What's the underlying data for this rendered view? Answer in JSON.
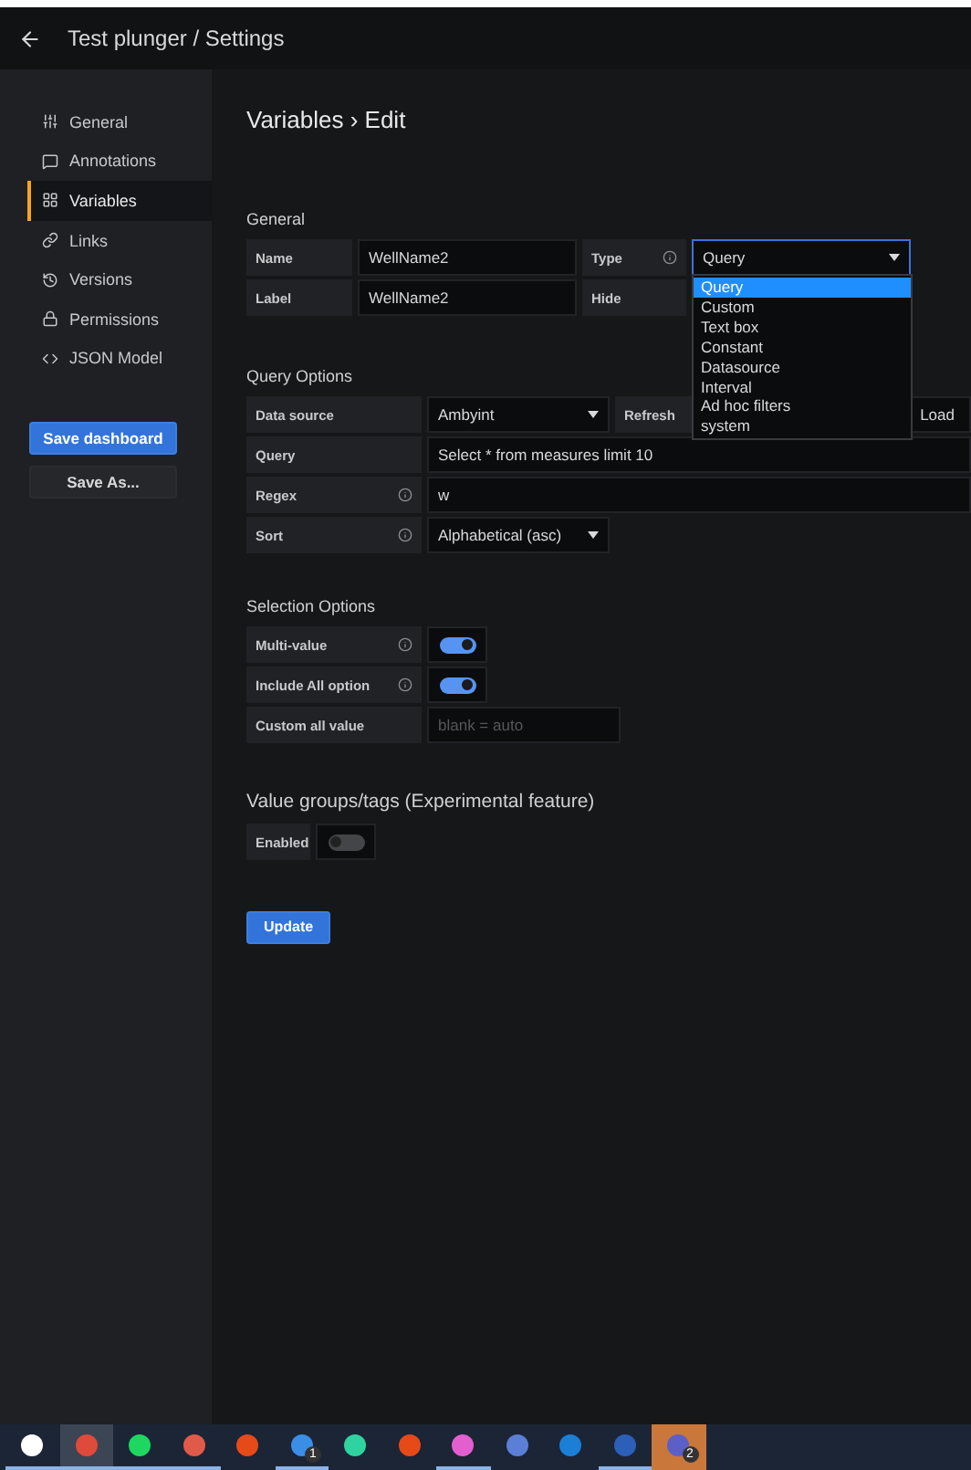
{
  "header": {
    "title": "Test plunger / Settings"
  },
  "sidebar": {
    "items": [
      {
        "label": "General",
        "selected": false
      },
      {
        "label": "Annotations",
        "selected": false
      },
      {
        "label": "Variables",
        "selected": true
      },
      {
        "label": "Links",
        "selected": false
      },
      {
        "label": "Versions",
        "selected": false
      },
      {
        "label": "Permissions",
        "selected": false
      },
      {
        "label": "JSON Model",
        "selected": false
      }
    ],
    "buttons": [
      {
        "label": "Save dashboard",
        "kind": "primary"
      },
      {
        "label": "Save As...",
        "kind": "secondary"
      }
    ]
  },
  "page_title": "Variables › Edit",
  "general": {
    "heading": "General",
    "name": {
      "label": "Name",
      "value": "WellName2"
    },
    "type": {
      "label": "Type",
      "value": "Query",
      "options": [
        {
          "label": "Query",
          "selected": true
        },
        {
          "label": "Custom",
          "selected": false
        },
        {
          "label": "Text box",
          "selected": false
        },
        {
          "label": "Constant",
          "selected": false
        },
        {
          "label": "Datasource",
          "selected": false
        },
        {
          "label": "Interval",
          "selected": false
        },
        {
          "label": "Ad hoc filters",
          "selected": false
        },
        {
          "label": "system",
          "selected": false
        }
      ]
    },
    "display_label": {
      "label": "Label",
      "value": "WellName2"
    },
    "hide": {
      "label": "Hide"
    }
  },
  "query_options": {
    "heading": "Query Options",
    "data_source": {
      "label": "Data source",
      "value": "Ambyint"
    },
    "refresh": {
      "label": "Refresh",
      "value": "Load"
    },
    "query": {
      "label": "Query",
      "value": "Select * from measures limit 10"
    },
    "regex": {
      "label": "Regex",
      "value": "w"
    },
    "sort": {
      "label": "Sort",
      "value": "Alphabetical (asc)"
    }
  },
  "selection_options": {
    "heading": "Selection Options",
    "multi_value": {
      "label": "Multi-value",
      "on": true
    },
    "include_all": {
      "label": "Include All option",
      "on": true
    },
    "custom_all": {
      "label": "Custom all value",
      "placeholder": "blank = auto"
    }
  },
  "value_groups": {
    "heading": "Value groups/tags (Experimental feature)",
    "enabled": {
      "label": "Enabled",
      "on": false
    }
  },
  "update_button": "Update",
  "taskbar": [
    {
      "color": "#ffffff",
      "selected": false,
      "running": true
    },
    {
      "color": "#e04a3a",
      "selected": true,
      "running": true
    },
    {
      "color": "#1ed760",
      "selected": false,
      "running": true
    },
    {
      "color": "#e05a4a",
      "selected": false,
      "running": true
    },
    {
      "color": "#e64a19",
      "selected": false,
      "running": false
    },
    {
      "color": "#3a8ee6",
      "selected": false,
      "running": true,
      "badge": "1"
    },
    {
      "color": "#2fd3a0",
      "selected": false,
      "running": false
    },
    {
      "color": "#e64a19",
      "selected": false,
      "running": false
    },
    {
      "color": "#e35fd0",
      "selected": false,
      "running": true
    },
    {
      "color": "#5b7fd6",
      "selected": false,
      "running": false
    },
    {
      "color": "#1b7fd6",
      "selected": false,
      "running": false
    },
    {
      "color": "#2b5fb8",
      "selected": false,
      "running": true
    },
    {
      "color": "#5b5fc7",
      "selected": false,
      "running": false,
      "flashing": true,
      "badge": "2"
    }
  ]
}
